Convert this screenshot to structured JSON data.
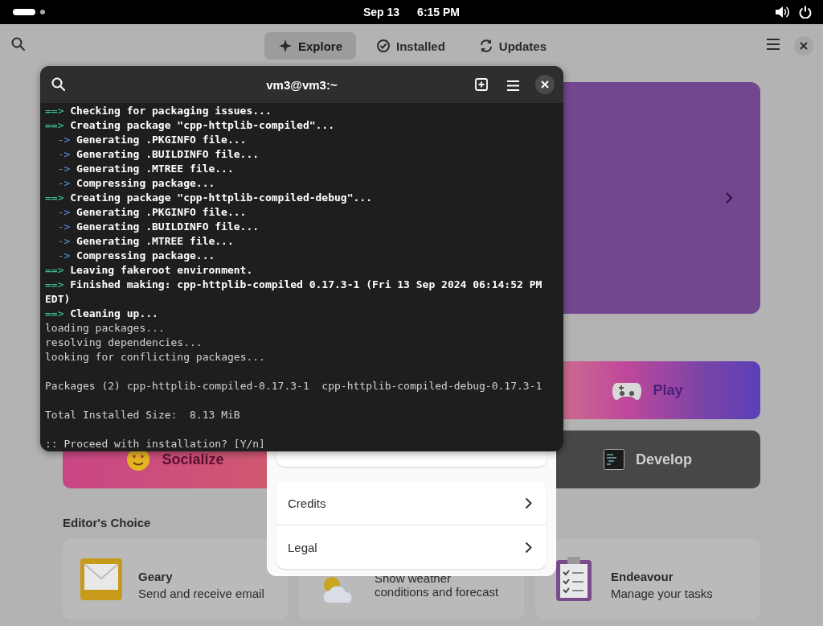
{
  "top_bar": {
    "date": "Sep 13",
    "time": "6:15 PM"
  },
  "header": {
    "tabs": [
      {
        "label": "Explore",
        "selected": true
      },
      {
        "label": "Installed",
        "selected": false
      },
      {
        "label": "Updates",
        "selected": false
      }
    ]
  },
  "categories": [
    {
      "label": "Play",
      "kind": "play"
    },
    {
      "label": "Socialize",
      "kind": "socialize"
    },
    {
      "label": "Develop",
      "kind": "develop"
    }
  ],
  "editors_choice": {
    "heading": "Editor's Choice",
    "apps": [
      {
        "name": "Geary",
        "description": "Send and receive email"
      },
      {
        "description": "Show weather conditions and forecast"
      },
      {
        "name": "Endeavour",
        "description": "Manage your tasks"
      }
    ]
  },
  "dialog": {
    "rows": [
      {
        "label": "Credits"
      },
      {
        "label": "Legal"
      }
    ]
  },
  "terminal": {
    "title": "vm3@vm3:~",
    "lines": [
      {
        "kind": "step",
        "marker": "==>",
        "text": "Checking for packaging issues..."
      },
      {
        "kind": "step",
        "marker": "==>",
        "text": "Creating package \"cpp-httplib-compiled\"..."
      },
      {
        "kind": "substep",
        "marker": "->",
        "text": "Generating .PKGINFO file..."
      },
      {
        "kind": "substep",
        "marker": "->",
        "text": "Generating .BUILDINFO file..."
      },
      {
        "kind": "substep",
        "marker": "->",
        "text": "Generating .MTREE file..."
      },
      {
        "kind": "substep",
        "marker": "->",
        "text": "Compressing package..."
      },
      {
        "kind": "step",
        "marker": "==>",
        "text": "Creating package \"cpp-httplib-compiled-debug\"..."
      },
      {
        "kind": "substep",
        "marker": "->",
        "text": "Generating .PKGINFO file..."
      },
      {
        "kind": "substep",
        "marker": "->",
        "text": "Generating .BUILDINFO file..."
      },
      {
        "kind": "substep",
        "marker": "->",
        "text": "Generating .MTREE file..."
      },
      {
        "kind": "substep",
        "marker": "->",
        "text": "Compressing package..."
      },
      {
        "kind": "step",
        "marker": "==>",
        "text": "Leaving fakeroot environment."
      },
      {
        "kind": "step",
        "marker": "==>",
        "text": "Finished making: cpp-httplib-compiled 0.17.3-1 (Fri 13 Sep 2024 06:14:52 PM"
      },
      {
        "kind": "wrap",
        "text": "EDT)"
      },
      {
        "kind": "step",
        "marker": "==>",
        "text": "Cleaning up..."
      },
      {
        "kind": "output",
        "text": "loading packages..."
      },
      {
        "kind": "output",
        "text": "resolving dependencies..."
      },
      {
        "kind": "output",
        "text": "looking for conflicting packages..."
      },
      {
        "kind": "blank"
      },
      {
        "kind": "output",
        "text": "Packages (2) cpp-httplib-compiled-0.17.3-1  cpp-httplib-compiled-debug-0.17.3-1"
      },
      {
        "kind": "blank"
      },
      {
        "kind": "output",
        "text": "Total Installed Size:  8.13 MiB"
      },
      {
        "kind": "blank"
      },
      {
        "kind": "output",
        "text": ":: Proceed with installation? [Y/n]"
      }
    ]
  }
}
